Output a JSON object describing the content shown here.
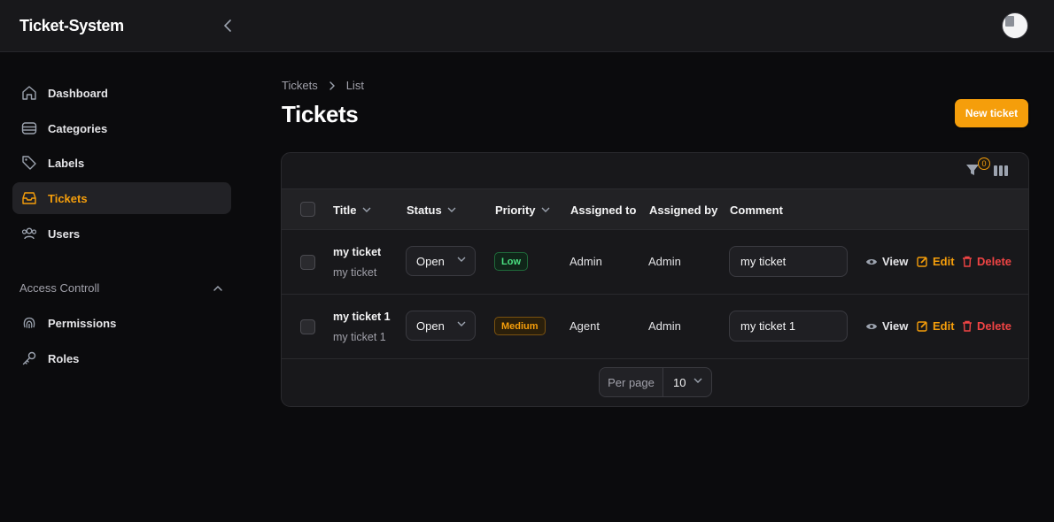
{
  "app": {
    "title": "Ticket-System"
  },
  "sidebar": {
    "items": [
      {
        "label": "Dashboard",
        "icon": "home-icon"
      },
      {
        "label": "Categories",
        "icon": "stack-icon"
      },
      {
        "label": "Labels",
        "icon": "tag-icon"
      },
      {
        "label": "Tickets",
        "icon": "inbox-icon",
        "active": true
      },
      {
        "label": "Users",
        "icon": "users-icon"
      }
    ],
    "group": {
      "heading": "Access Controll",
      "items": [
        {
          "label": "Permissions",
          "icon": "fingerprint-icon"
        },
        {
          "label": "Roles",
          "icon": "key-icon"
        }
      ]
    }
  },
  "breadcrumb": {
    "items": [
      "Tickets",
      "List"
    ]
  },
  "page": {
    "title": "Tickets",
    "new_button": "New ticket"
  },
  "table": {
    "filter_count": "0",
    "columns": [
      "Title",
      "Status",
      "Priority",
      "Assigned to",
      "Assigned by",
      "Comment"
    ],
    "rows": [
      {
        "title": "my ticket",
        "subtitle": "my ticket",
        "status": "Open",
        "priority": "Low",
        "assigned_to": "Admin",
        "assigned_by": "Admin",
        "comment": "my ticket"
      },
      {
        "title": "my ticket 1",
        "subtitle": "my ticket 1",
        "status": "Open",
        "priority": "Medium",
        "assigned_to": "Agent",
        "assigned_by": "Admin",
        "comment": "my ticket 1"
      }
    ],
    "actions": {
      "view": "View",
      "edit": "Edit",
      "delete": "Delete"
    },
    "pagination": {
      "per_page_label": "Per page",
      "per_page_value": "10"
    }
  },
  "colors": {
    "accent": "#f59e0b",
    "danger": "#ef4444",
    "success": "#4ade80"
  }
}
